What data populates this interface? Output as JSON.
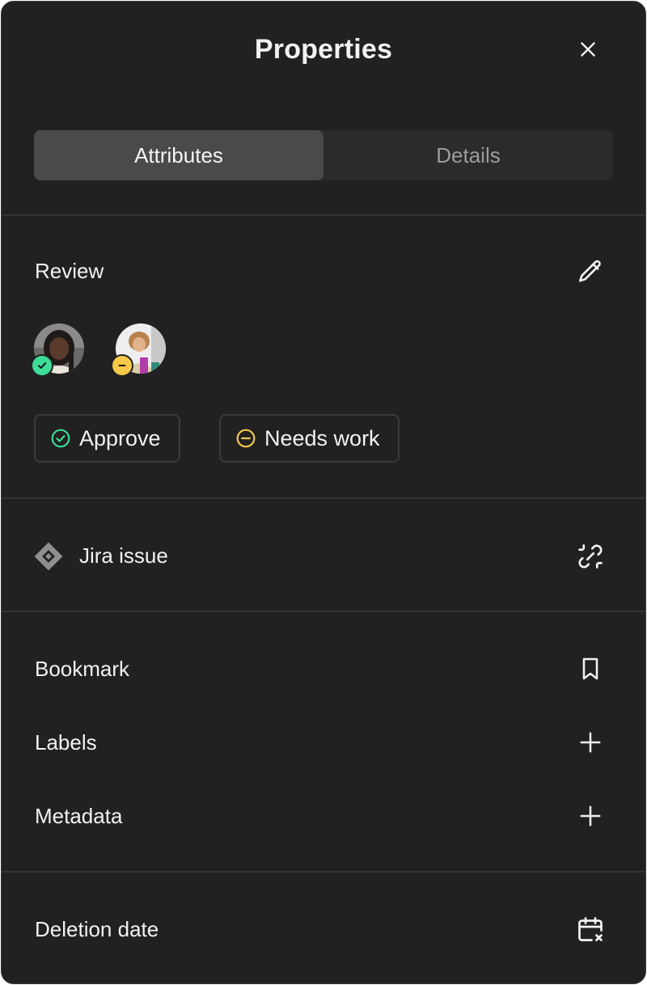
{
  "header": {
    "title": "Properties"
  },
  "tabs": [
    {
      "label": "Attributes",
      "active": true
    },
    {
      "label": "Details",
      "active": false
    }
  ],
  "review": {
    "label": "Review",
    "reviewers": [
      {
        "status": "approved",
        "status_color": "#3ddc97"
      },
      {
        "status": "needs-work",
        "status_color": "#f7c948"
      }
    ],
    "actions": [
      {
        "label": "Approve",
        "icon": "check-circle-icon",
        "color": "#3ddc97"
      },
      {
        "label": "Needs work",
        "icon": "minus-circle-icon",
        "color": "#f7c948"
      }
    ]
  },
  "jira": {
    "label": "Jira issue",
    "icon": "jira-logo-icon",
    "action_icon": "unlink-icon"
  },
  "properties": [
    {
      "label": "Bookmark",
      "icon": "bookmark-icon"
    },
    {
      "label": "Labels",
      "icon": "plus-icon"
    },
    {
      "label": "Metadata",
      "icon": "plus-icon"
    }
  ],
  "deletion": {
    "label": "Deletion date",
    "icon": "calendar-x-icon"
  },
  "colors": {
    "background": "#212121",
    "divider": "#343434",
    "tab_active": "#4a4a4a",
    "tab_track": "#2b2b2b"
  }
}
